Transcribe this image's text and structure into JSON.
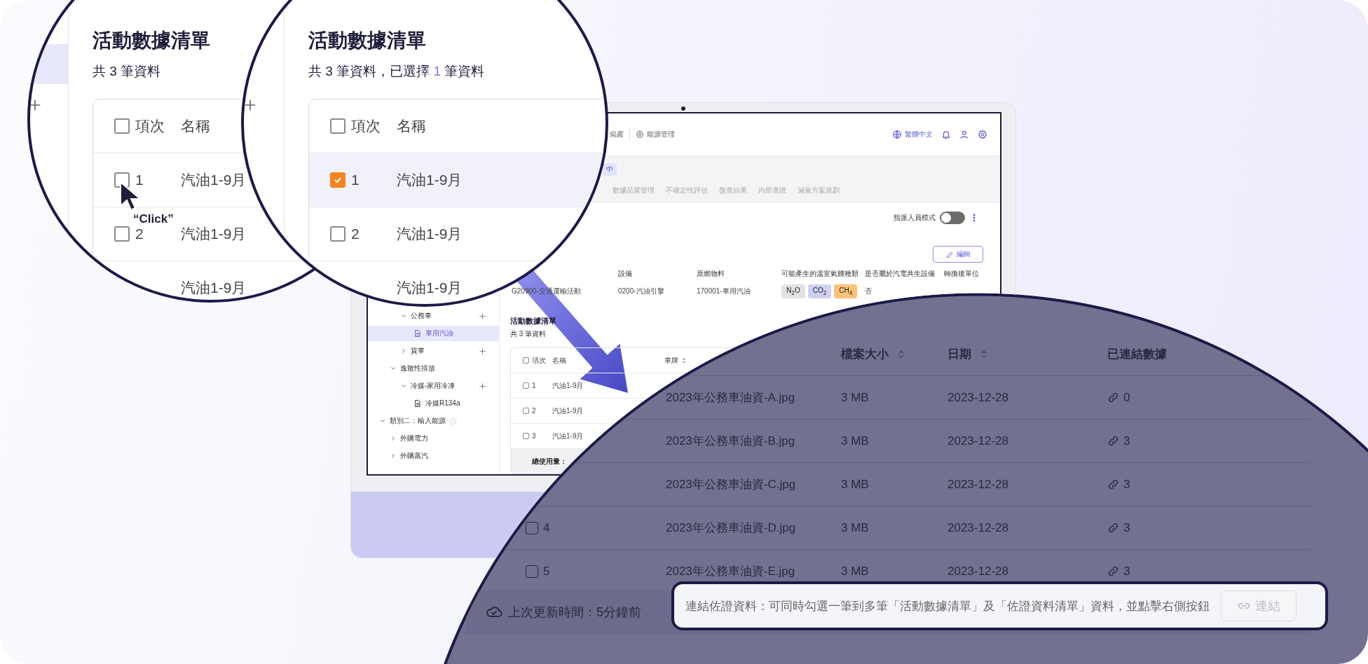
{
  "zoom_lens_left": {
    "title": "活動數據清單",
    "summary": "共 3 筆資料",
    "all_checked": false,
    "columns": [
      "項次",
      "名稱"
    ],
    "rows": [
      {
        "number": "1",
        "name": "汽油1-9月",
        "checked": false,
        "selected": false
      },
      {
        "number": "2",
        "name": "汽油1-9月",
        "checked": false,
        "selected": false
      },
      {
        "name": "汽油1-9月"
      }
    ],
    "cursor_label": "“Click”"
  },
  "zoom_lens_right": {
    "title": "活動數據清單",
    "summary_before": "共 3 筆資料，已選擇 ",
    "selected_count": "1",
    "summary_after": " 筆資料",
    "all_checked": false,
    "columns": [
      "項次",
      "名稱"
    ],
    "rows": [
      {
        "number": "1",
        "name": "汽油1-9月",
        "checked": true,
        "selected": true
      },
      {
        "number": "2",
        "name": "汽油1-9月",
        "checked": false,
        "selected": false
      },
      {
        "name": "汽油1-9月"
      }
    ]
  },
  "laptop": {
    "nav": [
      {
        "label": "揭露",
        "kind": "plain"
      },
      {
        "label": "能源管理",
        "kind": "gear"
      }
    ],
    "language": "繁體中文",
    "status_badge": "中",
    "tabs": [
      {
        "label": "數據品質管理",
        "selected": false
      },
      {
        "label": "不確定性評估",
        "selected": false
      },
      {
        "label": "盤查結果",
        "selected": false
      },
      {
        "label": "內部查證",
        "selected": false
      },
      {
        "label": "減量方案規劃",
        "selected": false
      }
    ],
    "assign_mode": {
      "label": "指派人員模式",
      "on": false
    },
    "edit_button": "編輯",
    "info": [
      {
        "value": "G20900-交通運輸活動"
      },
      {
        "label": "設備",
        "value": "0200-汽油引擎"
      },
      {
        "label": "原燃物料",
        "value": "170001-車用汽油"
      },
      {
        "label": "可能產生的溫室氣體種類",
        "gases": [
          {
            "label": "N$_{2}$O",
            "color": "#e2e2e4"
          },
          {
            "label": "CO$_{2}$",
            "color": "#cfd0f4"
          },
          {
            "label": "CH$_{4}$",
            "color": "#fbc27a"
          }
        ]
      },
      {
        "label": "是否屬於汽電共生設備",
        "value": "否"
      },
      {
        "label": "轉換後單位"
      }
    ],
    "tree": [
      {
        "children": [
          {
            "children": [
              {
                "label": "公務車",
                "expanded": true,
                "add": true,
                "children": [
                  {
                    "label": "車用汽油",
                    "selected": true
                  }
                ]
              },
              {
                "label": "貨車",
                "expanded": false,
                "add": true
              }
            ]
          },
          {
            "label": "逸散性排放",
            "expanded": true,
            "children": [
              {
                "label": "冷媒-家用冷凍",
                "expanded": true,
                "add": true,
                "children": [
                  {
                    "label": "冷媒R134a",
                    "selected": false
                  }
                ]
              }
            ]
          }
        ]
      },
      {
        "label": "類別二：輸入能源",
        "expanded": true,
        "done": true,
        "children": [
          {
            "label": "外購電力",
            "expanded": false
          },
          {
            "label": "外購蒸汽",
            "expanded": false
          }
        ]
      }
    ],
    "list": {
      "title": "活動數據清單",
      "summary": "共 3 筆資料",
      "all_checked": false,
      "columns": [
        "項次",
        "名稱",
        "車牌"
      ],
      "rows": [
        {
          "number": "1",
          "name": "汽油1-9月",
          "checked": false
        },
        {
          "number": "2",
          "name": "汽油1-9月",
          "checked": false
        },
        {
          "number": "3",
          "name": "汽油1-9月",
          "checked": false
        }
      ],
      "total_label": "總使用量："
    }
  },
  "file_panel": {
    "columns": [
      "檔案大小",
      "日期",
      "已連結數據"
    ],
    "rows": [
      {
        "file": "2023年公務車油資-A.jpg",
        "size": "3 MB",
        "date": "2023-12-28",
        "linked": "0"
      },
      {
        "file": "2023年公務車油資-B.jpg",
        "size": "3 MB",
        "date": "2023-12-28",
        "linked": "3"
      },
      {
        "file": "2023年公務車油資-C.jpg",
        "size": "3 MB",
        "date": "2023-12-28",
        "linked": "3"
      },
      {
        "number": "4",
        "checked": false,
        "file": "2023年公務車油資-D.jpg",
        "size": "3 MB",
        "date": "2023-12-28",
        "linked": "3"
      },
      {
        "number": "5",
        "checked": false,
        "file": "2023年公務車油資-E.jpg",
        "size": "3 MB",
        "date": "2023-12-28",
        "linked": "3"
      }
    ],
    "last_update": "上次更新時間：5分鐘前",
    "hint": "連結佐證資料：可同時勾選一筆到多筆「活動數據清單」及「佐證資料清單」資料，並點擊右側按鈕",
    "link_button": {
      "label": "連結",
      "disabled": true
    }
  }
}
